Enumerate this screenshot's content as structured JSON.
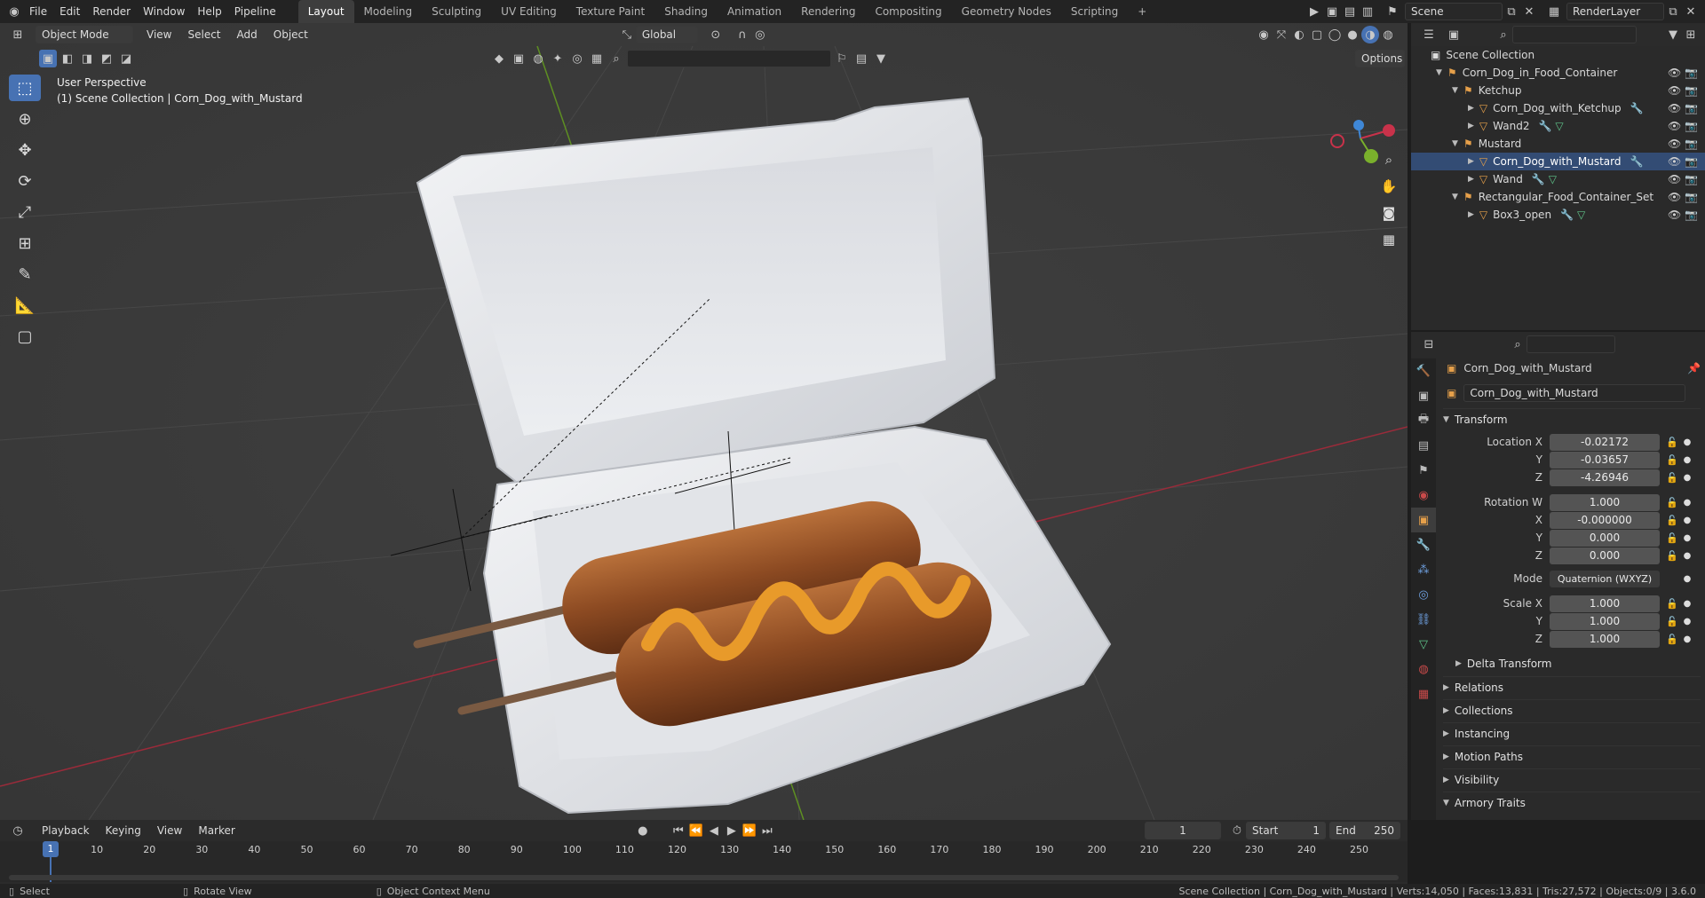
{
  "topbar": {
    "menus": [
      "File",
      "Edit",
      "Render",
      "Window",
      "Help",
      "Pipeline"
    ],
    "workspaces": [
      "Layout",
      "Modeling",
      "Sculpting",
      "UV Editing",
      "Texture Paint",
      "Shading",
      "Animation",
      "Rendering",
      "Compositing",
      "Geometry Nodes",
      "Scripting"
    ],
    "add_ws": "+",
    "scene": "Scene",
    "render_layer": "RenderLayer"
  },
  "viewport": {
    "mode": "Object Mode",
    "menus": [
      "View",
      "Select",
      "Add",
      "Object"
    ],
    "orientation": "Global",
    "options": "Options",
    "overlay_title": "User Perspective",
    "overlay_sub": "(1) Scene Collection | Corn_Dog_with_Mustard",
    "gizmo": {
      "x": "X",
      "y": "Y",
      "z": "Z"
    }
  },
  "outliner": {
    "root": "Scene Collection",
    "items": [
      {
        "label": "Corn_Dog_in_Food_Container",
        "depth": 1
      },
      {
        "label": "Ketchup",
        "depth": 2
      },
      {
        "label": "Corn_Dog_with_Ketchup",
        "depth": 3
      },
      {
        "label": "Wand2",
        "depth": 3
      },
      {
        "label": "Mustard",
        "depth": 2
      },
      {
        "label": "Corn_Dog_with_Mustard",
        "depth": 3
      },
      {
        "label": "Wand",
        "depth": 3
      },
      {
        "label": "Rectangular_Food_Container_Set",
        "depth": 2
      },
      {
        "label": "Box3_open",
        "depth": 3
      }
    ]
  },
  "properties": {
    "object_name": "Corn_Dog_with_Mustard",
    "datablock": "Corn_Dog_with_Mustard",
    "transform_header": "Transform",
    "location": {
      "label": "Location X",
      "x": "-0.02172",
      "y": "-0.03657",
      "z": "-4.26946"
    },
    "rotation": {
      "label": "Rotation W",
      "w": "1.000",
      "x": "-0.000000",
      "y": "0.000",
      "z": "0.000"
    },
    "mode_label": "Mode",
    "mode_value": "Quaternion (WXYZ)",
    "scale": {
      "label": "Scale X",
      "x": "1.000",
      "y": "1.000",
      "z": "1.000"
    },
    "axis_y": "Y",
    "axis_z": "Z",
    "axis_x": "X",
    "panels": [
      "Delta Transform",
      "Relations",
      "Collections",
      "Instancing",
      "Motion Paths",
      "Visibility",
      "Armory Traits"
    ]
  },
  "timeline": {
    "menus": [
      "Playback",
      "Keying",
      "View",
      "Marker"
    ],
    "current_frame": "1",
    "start_label": "Start",
    "start": "1",
    "end_label": "End",
    "end": "250",
    "ticks": [
      "1",
      "10",
      "20",
      "30",
      "40",
      "50",
      "60",
      "70",
      "80",
      "90",
      "100",
      "110",
      "120",
      "130",
      "140",
      "150",
      "160",
      "170",
      "180",
      "190",
      "200",
      "210",
      "220",
      "230",
      "240",
      "250"
    ]
  },
  "statusbar": {
    "select": "Select",
    "rotate": "Rotate View",
    "context": "Object Context Menu",
    "stats": "Scene Collection | Corn_Dog_with_Mustard | Verts:14,050 | Faces:13,831 | Tris:27,572 | Objects:0/9 | 3.6.0"
  },
  "colors": {
    "accent": "#4772b3",
    "x_axis": "#c8324a",
    "y_axis": "#7ab02c",
    "z_axis": "#3f87d6",
    "mustard": "#e89a2a"
  }
}
